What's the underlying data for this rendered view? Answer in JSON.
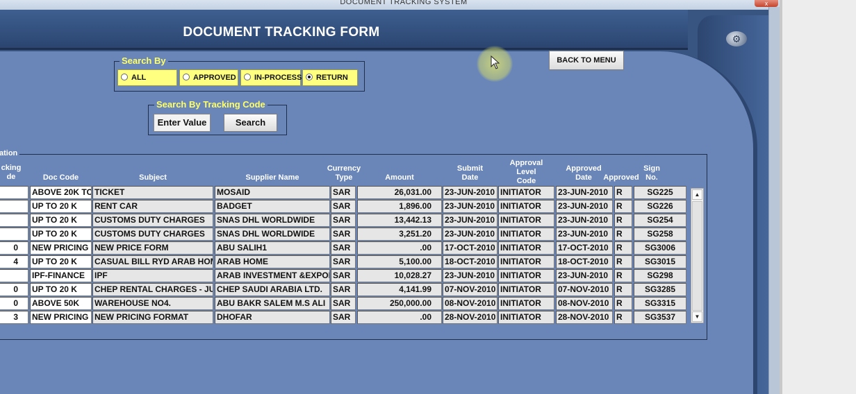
{
  "window": {
    "title": "DOCUMENT TRACKING SYSTEM",
    "close_glyph": "x"
  },
  "form": {
    "header_title": "DOCUMENT TRACKING FORM",
    "gear_glyph": "⚙"
  },
  "buttons": {
    "back_to_menu": "BACK TO MENU",
    "search": "Search"
  },
  "search_by": {
    "legend": "Search By",
    "options": [
      {
        "label": "ALL",
        "selected": false
      },
      {
        "label": "APPROVED",
        "selected": false
      },
      {
        "label": "IN-PROCESS",
        "selected": false
      },
      {
        "label": "RETURN",
        "selected": true
      }
    ]
  },
  "tracking_code": {
    "legend": "Search By Tracking Code",
    "value": "Enter Value"
  },
  "grid": {
    "legend": "ation",
    "headers": {
      "tracking": "cking\nde",
      "doc_code": "Doc Code",
      "subject": "Subject",
      "supplier": "Supplier Name",
      "currency": "Currency\nType",
      "amount": "Amount",
      "submit": "Submit\nDate",
      "approval_code": "Approval\nLevel\nCode",
      "approved_date": "Approved\nDate",
      "approved": "Approved",
      "sign": "Sign\nNo."
    },
    "rows": [
      {
        "tracking": "",
        "doc_code": "ABOVE 20K TO",
        "subject": "TICKET",
        "supplier": "MOSAID",
        "currency": "SAR",
        "amount": "26,031.00",
        "submit": "23-JUN-2010",
        "approval_code": "INITIATOR",
        "approved_date": "23-JUN-2010",
        "approved": "R",
        "sign": "SG225"
      },
      {
        "tracking": "",
        "doc_code": "UP TO 20 K",
        "subject": "RENT CAR",
        "supplier": "BADGET",
        "currency": "SAR",
        "amount": "1,896.00",
        "submit": "23-JUN-2010",
        "approval_code": "INITIATOR",
        "approved_date": "23-JUN-2010",
        "approved": "R",
        "sign": "SG226"
      },
      {
        "tracking": "",
        "doc_code": "UP TO 20 K",
        "subject": "CUSTOMS DUTY CHARGES",
        "supplier": "SNAS DHL WORLDWIDE",
        "currency": "SAR",
        "amount": "13,442.13",
        "submit": "23-JUN-2010",
        "approval_code": "INITIATOR",
        "approved_date": "23-JUN-2010",
        "approved": "R",
        "sign": "SG254"
      },
      {
        "tracking": "",
        "doc_code": "UP TO 20 K",
        "subject": "CUSTOMS DUTY CHARGES",
        "supplier": "SNAS DHL WORLDWIDE",
        "currency": "SAR",
        "amount": "3,251.20",
        "submit": "23-JUN-2010",
        "approval_code": "INITIATOR",
        "approved_date": "23-JUN-2010",
        "approved": "R",
        "sign": "SG258"
      },
      {
        "tracking": "0",
        "doc_code": "NEW PRICING",
        "subject": "NEW PRICE FORM",
        "supplier": "ABU SALIH1",
        "currency": "SAR",
        "amount": ".00",
        "submit": "17-OCT-2010",
        "approval_code": "INITIATOR",
        "approved_date": "17-OCT-2010",
        "approved": "R",
        "sign": "SG3006"
      },
      {
        "tracking": "4",
        "doc_code": "UP TO 20 K",
        "subject": "CASUAL BILL RYD ARAB HOME",
        "supplier": "ARAB HOME",
        "currency": "SAR",
        "amount": "5,100.00",
        "submit": "18-OCT-2010",
        "approval_code": "INITIATOR",
        "approved_date": "18-OCT-2010",
        "approved": "R",
        "sign": "SG3015"
      },
      {
        "tracking": "",
        "doc_code": "IPF-FINANCE",
        "subject": "IPF",
        "supplier": "ARAB INVESTMENT &EXPORT",
        "currency": "SAR",
        "amount": "10,028.27",
        "submit": "23-JUN-2010",
        "approval_code": "INITIATOR",
        "approved_date": "23-JUN-2010",
        "approved": "R",
        "sign": "SG298"
      },
      {
        "tracking": "0",
        "doc_code": "UP TO 20 K",
        "subject": "CHEP RENTAL CHARGES - JUNE",
        "supplier": "CHEP SAUDI ARABIA LTD.",
        "currency": "SAR",
        "amount": "4,141.99",
        "submit": "07-NOV-2010",
        "approval_code": "INITIATOR",
        "approved_date": "07-NOV-2010",
        "approved": "R",
        "sign": "SG3285"
      },
      {
        "tracking": "0",
        "doc_code": "ABOVE 50K",
        "subject": "WAREHOUSE NO4.",
        "supplier": "ABU BAKR SALEM M.S ALI",
        "currency": "SAR",
        "amount": "250,000.00",
        "submit": "08-NOV-2010",
        "approval_code": "INITIATOR",
        "approved_date": "08-NOV-2010",
        "approved": "R",
        "sign": "SG3315"
      },
      {
        "tracking": "3",
        "doc_code": "NEW PRICING",
        "subject": "NEW PRICING FORMAT",
        "supplier": "DHOFAR",
        "currency": "SAR",
        "amount": ".00",
        "submit": "28-NOV-2010",
        "approval_code": "INITIATOR",
        "approved_date": "28-NOV-2010",
        "approved": "R",
        "sign": "SG3537"
      }
    ]
  },
  "scrollbar": {
    "up_glyph": "▲",
    "down_glyph": "▼"
  },
  "colors": {
    "panel": "#6a86b8",
    "header": "#2b4570",
    "legend_yellow": "#ffff66",
    "radio_yellow": "#ffff80"
  }
}
